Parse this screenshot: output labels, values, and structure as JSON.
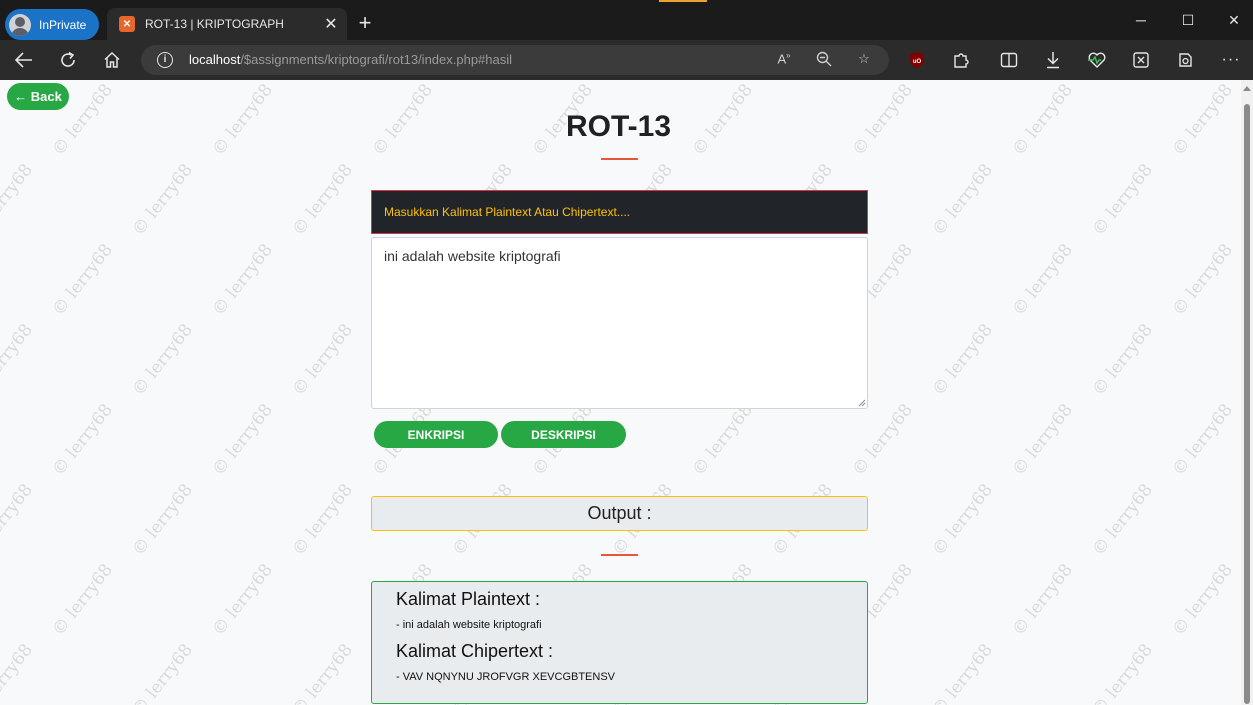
{
  "browser": {
    "inprivate_label": "InPrivate",
    "tab_title": "ROT-13 | KRIPTOGRAPH",
    "url_host": "localhost",
    "url_path": "/$assignments/kriptografi/rot13/index.php#hasil"
  },
  "page": {
    "back_label": "← Back",
    "title": "ROT-13",
    "prompt": "Masukkan Kalimat Plaintext Atau Chipertext....",
    "input_value": "ini adalah website kriptografi",
    "encrypt_label": "ENKRIPSI",
    "decrypt_label": "DESKRIPSI",
    "output_label": "Output :",
    "plaintext_heading": "Kalimat Plaintext :",
    "plaintext_value": "- ini adalah website kriptografi",
    "ciphertext_heading": "Kalimat Chipertext :",
    "ciphertext_value": "- VAV NQNYNU JROFVGR XEVCGBTENSV"
  },
  "watermark_text": "© lerry68",
  "colors": {
    "accent_green": "#28a745",
    "prompt_bg": "#212529",
    "prompt_text": "#ffc107",
    "underline": "#e8553a"
  }
}
